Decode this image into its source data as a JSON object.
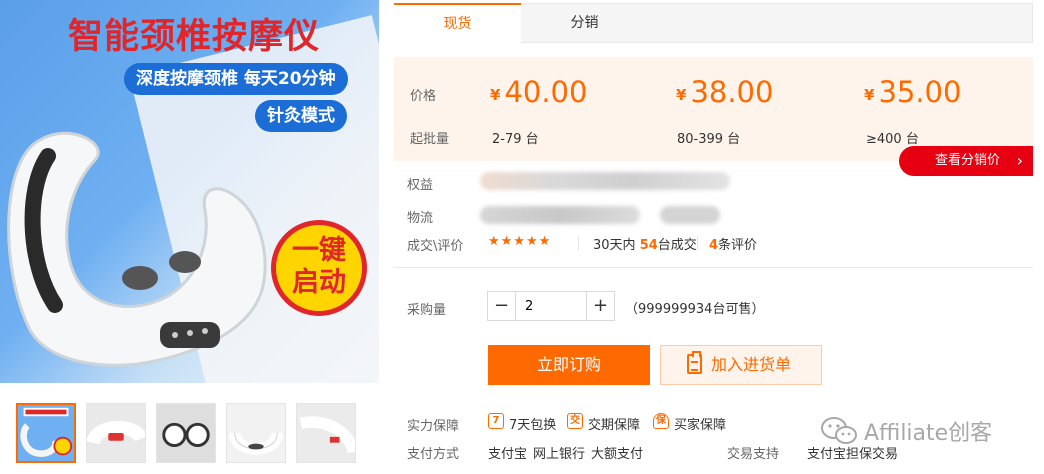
{
  "hero": {
    "title": "智能颈椎按摩仪",
    "tagline": "深度按摩颈椎 每天20分钟",
    "mode": "针灸模式",
    "badge_line1": "一键",
    "badge_line2": "启动"
  },
  "thumbnails": {
    "count": 5,
    "active_index": 0
  },
  "tabs": [
    "现货",
    "分销"
  ],
  "pricing": {
    "price_label": "价格",
    "moq_label": "起批量",
    "currency": "¥",
    "tiers": [
      {
        "price": "40.00",
        "range": "2-79 台"
      },
      {
        "price": "38.00",
        "range": "80-399 台"
      },
      {
        "price": "35.00",
        "range": "≥400 台"
      }
    ]
  },
  "distribution_button": "查看分销价",
  "rows": {
    "rights": "权益",
    "logistics": "物流",
    "reviews": "成交\\评价"
  },
  "stars": "★★★★★",
  "stats": {
    "prefix": "30天内",
    "deals_count": "54",
    "deals_suffix": "台成交",
    "review_count": "4",
    "review_suffix": "条评价"
  },
  "purchase": {
    "label": "采购量",
    "minus": "−",
    "plus": "+",
    "quantity": "2",
    "stock": "（999999934台可售）"
  },
  "buttons": {
    "buy_now": "立即订购",
    "add_to_list": "加入进货单"
  },
  "guarantees": {
    "label": "实力保障",
    "items": [
      {
        "icon": "7",
        "text": "7天包换"
      },
      {
        "icon": "交",
        "text": "交期保障"
      },
      {
        "icon": "保",
        "text": "买家保障"
      }
    ]
  },
  "payment": {
    "label": "支付方式",
    "methods": [
      "支付宝",
      "网上银行",
      "大额支付"
    ],
    "trade_label": "交易支持",
    "trade_value": "支付宝担保交易"
  },
  "watermark": "Affiliate创客",
  "colors": {
    "accent": "#ff6a00",
    "red": "#e60012",
    "price_bg": "#fff4ec"
  }
}
